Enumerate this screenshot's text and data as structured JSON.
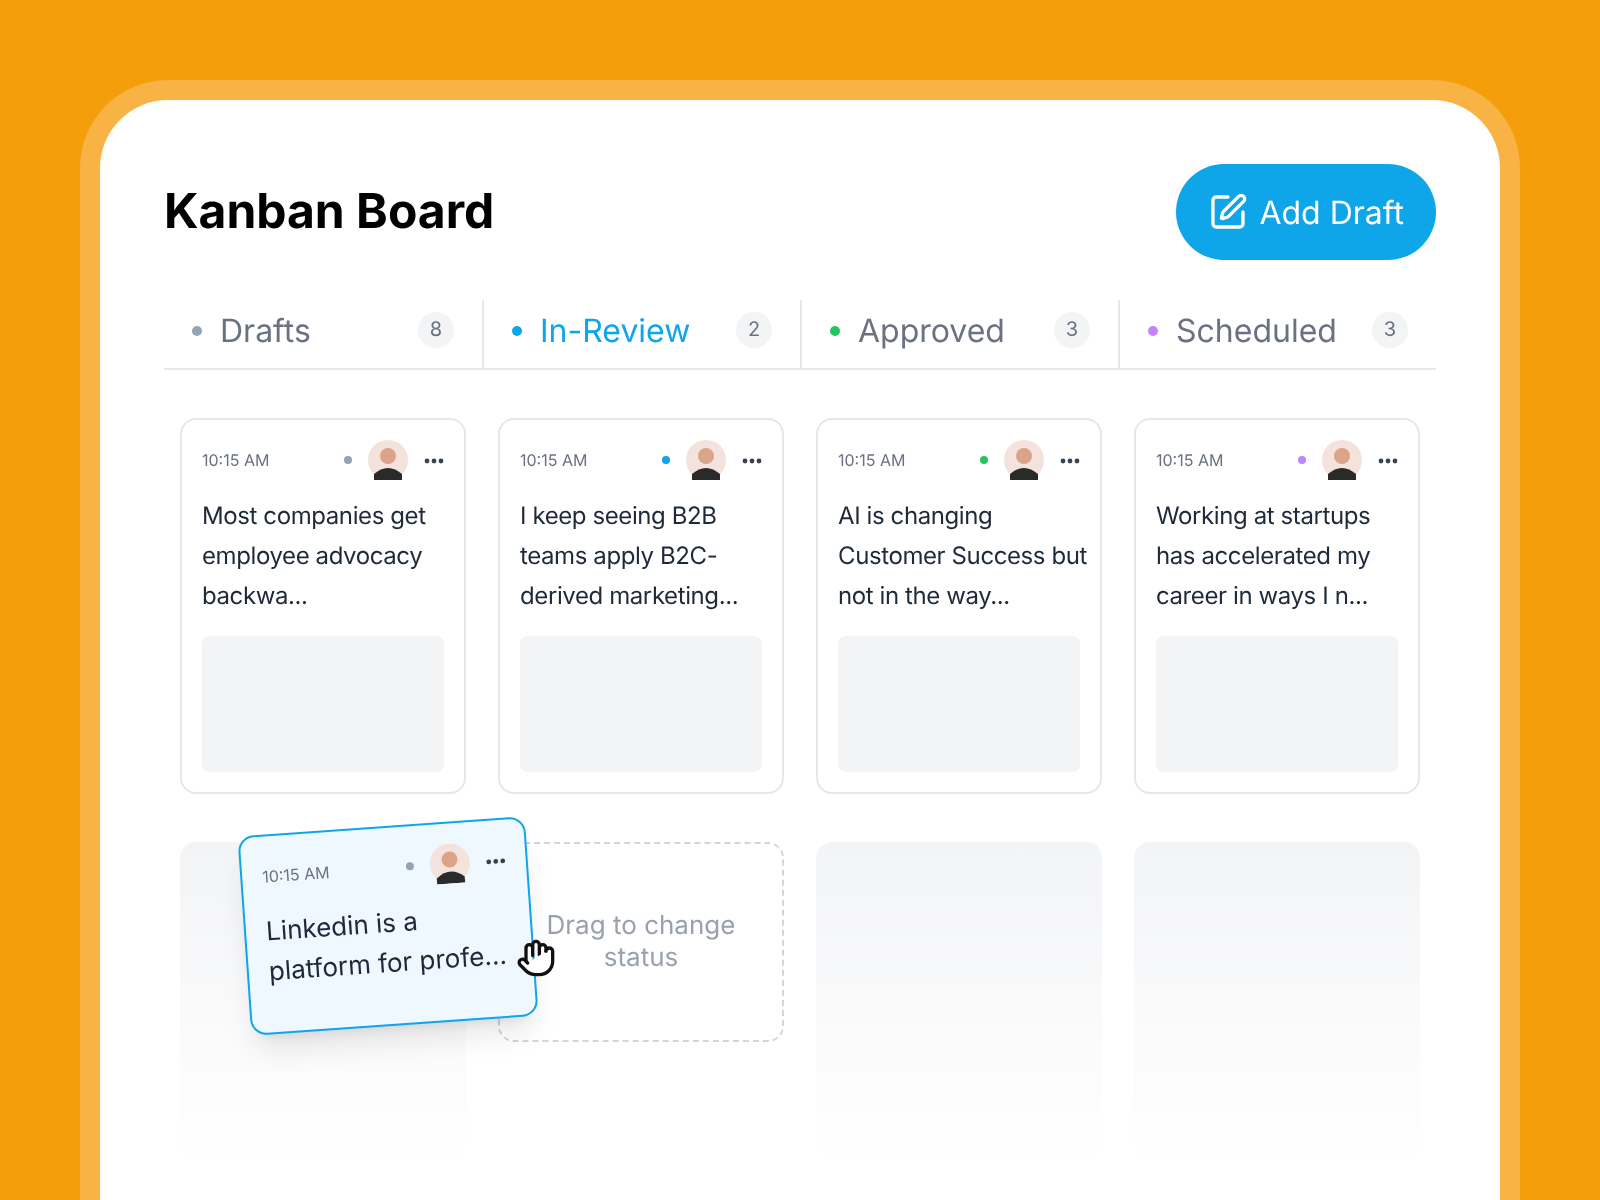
{
  "title": "Kanban Board",
  "add_button": {
    "label": "Add Draft"
  },
  "columns": [
    {
      "name": "Drafts",
      "color": "#94a3b8",
      "count": "8",
      "selected": false,
      "card": {
        "time": "10:15 AM",
        "text": "Most companies get employee advocacy backwa..."
      }
    },
    {
      "name": "In-Review",
      "color": "#0ea5e9",
      "count": "2",
      "selected": true,
      "card": {
        "time": "10:15 AM",
        "text": "I keep seeing B2B teams apply B2C-derived marketing..."
      }
    },
    {
      "name": "Approved",
      "color": "#22c55e",
      "count": "3",
      "selected": false,
      "card": {
        "time": "10:15 AM",
        "text": "AI is changing Customer Success but not in the way..."
      }
    },
    {
      "name": "Scheduled",
      "color": "#c084fc",
      "count": "3",
      "selected": false,
      "card": {
        "time": "10:15 AM",
        "text": "Working at startups has accelerated my career in ways I n..."
      }
    }
  ],
  "dragged_card": {
    "time": "10:15 AM",
    "text": "Linkedin is a platform for profe...",
    "color": "#94a3b8"
  },
  "drop_zone": {
    "hint": "Drag to change status"
  }
}
